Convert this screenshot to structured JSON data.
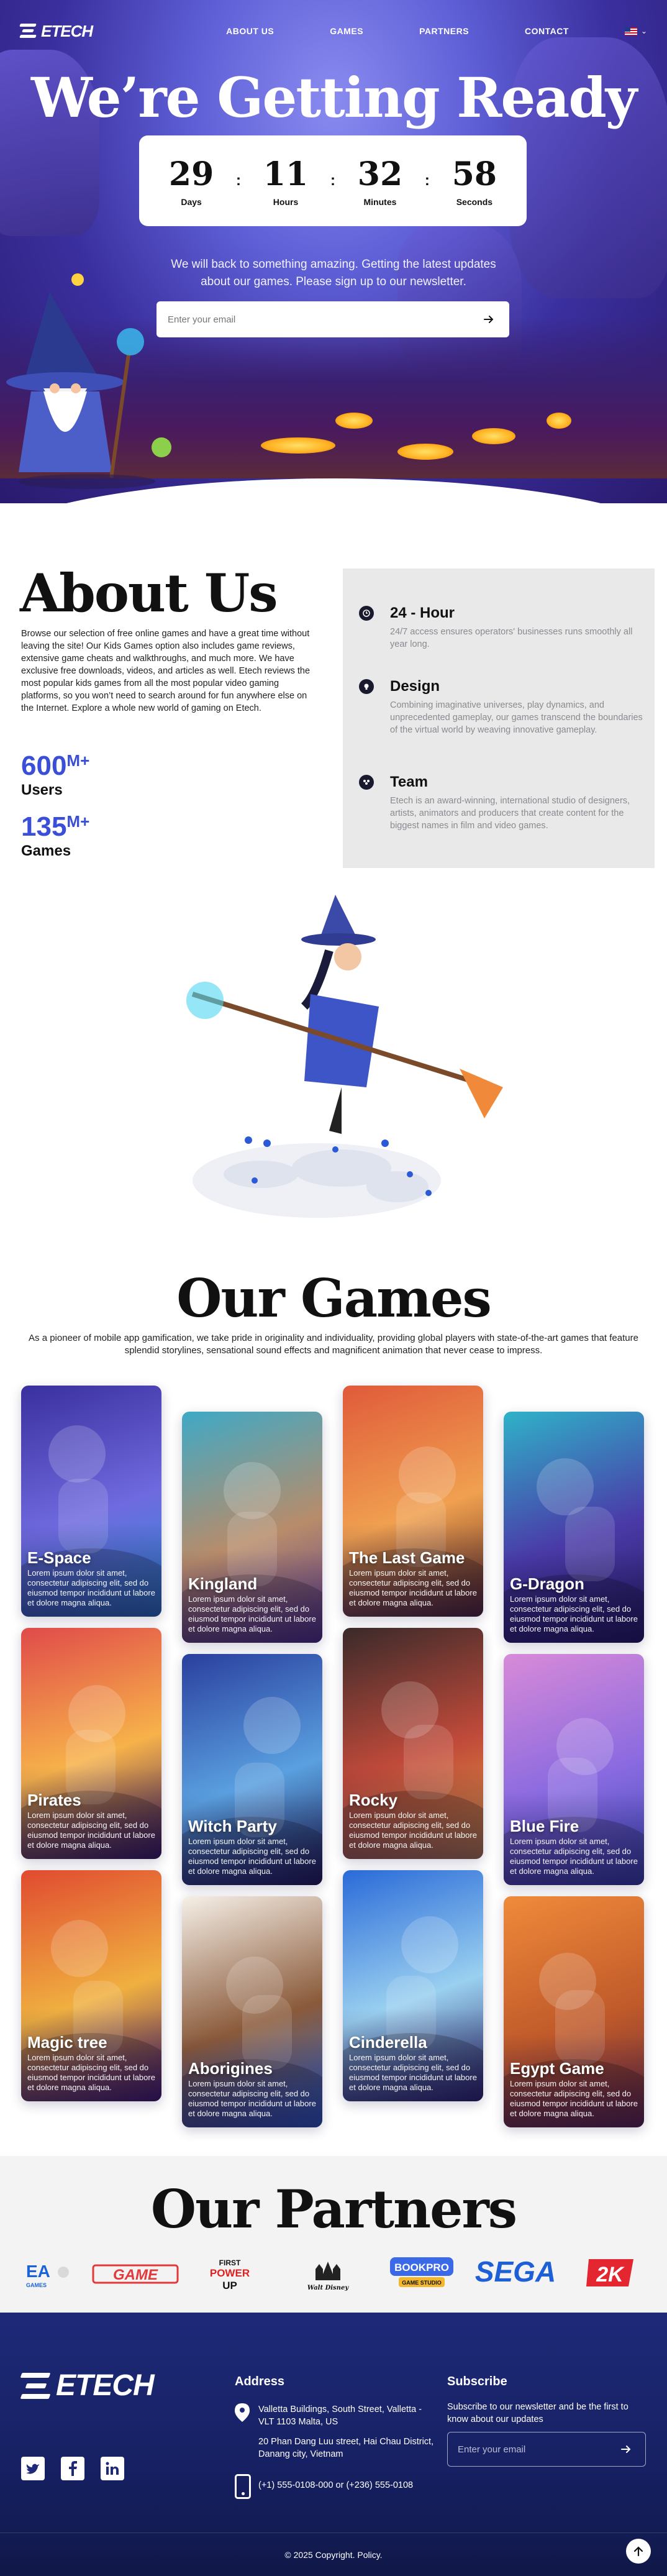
{
  "nav": {
    "logo": "ETECH",
    "links": [
      "ABOUT US",
      "GAMES",
      "PARTNERS",
      "CONTACT"
    ],
    "language_icon": "us-flag-icon"
  },
  "hero": {
    "title": "We’re Getting Ready",
    "countdown": [
      {
        "value": "29",
        "label": "Days"
      },
      {
        "value": "11",
        "label": "Hours"
      },
      {
        "value": "32",
        "label": "Minutes"
      },
      {
        "value": "58",
        "label": "Seconds"
      }
    ],
    "separator": ":",
    "subtitle": "We will back to something amazing. Getting the latest updates about our games. Please sign up to our newsletter.",
    "email_placeholder": "Enter your email"
  },
  "about": {
    "title": "About Us",
    "text": "Browse our selection of free online games and have a great time without leaving the site! Our Kids Games option also includes game reviews, extensive game cheats and walkthroughs, and much more. We have exclusive free downloads, videos, and articles as well. Etech reviews the most popular kids games from all the most popular video gaming platforms, so you won’t need to search around for fun anywhere else on the Internet. Explore a whole new world of gaming on Etech.",
    "stats": [
      {
        "value": "600",
        "suffix": "M+",
        "label": "Users"
      },
      {
        "value": "135",
        "suffix": "M+",
        "label": "Games"
      }
    ],
    "features": [
      {
        "icon": "clock-icon",
        "title": "24 - Hour",
        "desc": "24/7 access ensures operators' businesses runs smoothly all year long."
      },
      {
        "icon": "lightbulb-icon",
        "title": "Design",
        "desc": "Combining imaginative universes, play dynamics, and unprecedented gameplay, our games transcend the boundaries of the virtual world by weaving innovative gameplay."
      },
      {
        "icon": "team-icon",
        "title": "Team",
        "desc": "Etech is an award-winning, international studio of designers, artists, animators and producers that create content for the biggest names in film and video games."
      }
    ]
  },
  "games": {
    "title": "Our Games",
    "subtitle": "As a pioneer of mobile app gamification, we take pride in originality and individuality, providing global players with state-of-the-art games that feature splendid storylines, sensational sound effects and magnificent animation that never cease to impress.",
    "lorem": "Lorem ipsum dolor sit amet, consectetur adipiscing elit, sed do eiusmod tempor incididunt ut labore et dolore magna aliqua.",
    "items": [
      "E-Space",
      "Kingland",
      "The Last Game",
      "G-Dragon",
      "Pirates",
      "Witch Party",
      "Rocky",
      "Blue Fire",
      "Magic tree",
      "Aborigines",
      "Cinderella",
      "Egypt Game"
    ]
  },
  "partners": {
    "title": "Our Partners",
    "items": [
      "EA GAMES",
      "GAME",
      "FIRST POWER UP",
      "Walt Disney",
      "BOOKPRO",
      "SEGA",
      "2K"
    ]
  },
  "footer": {
    "logo": "ETECH",
    "address_heading": "Address",
    "address_1": "Valletta Buildings, South Street, Valletta - VLT 1103 Malta, US",
    "address_2": "20 Phan Dang Luu street, Hai Chau District, Danang city, Vietnam",
    "phone": "(+1) 555-0108-000 or (+236) 555-0108",
    "subscribe_heading": "Subscribe",
    "subscribe_text": "Subscribe to our newsletter and be the first to know about our updates",
    "email_placeholder": "Enter your email",
    "copyright": "© 2025 Copyright. Policy."
  }
}
